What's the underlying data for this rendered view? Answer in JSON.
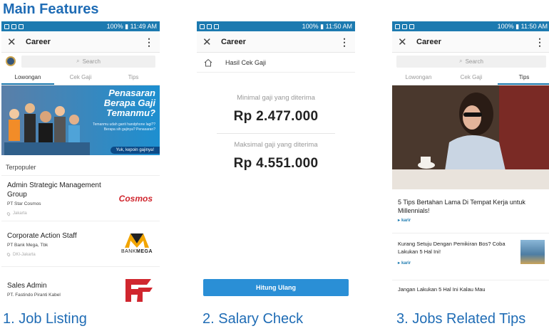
{
  "heading": "Main Features",
  "colors": {
    "accent": "#1f6cb5",
    "status_bar": "#1c7ab0",
    "button": "#2a8fd6",
    "cosmos_red": "#d0262e"
  },
  "screens": [
    {
      "status": {
        "icons": [
          "flipboard-icon",
          "facebook-icon",
          "instagram-icon"
        ],
        "right": "100% ▮ 11:49 AM"
      },
      "app_title": "Career",
      "search_placeholder": "Search",
      "tabs": [
        "Lowongan",
        "Cek Gaji",
        "Tips"
      ],
      "active_tab": 0,
      "banner": {
        "headline": "Penasaran Berapa Gaji Temanmu?",
        "sub": "Temanmu udah ganti handphone lagi?? Berapa sih gajinya? Penasaran?",
        "cta": "Yuk, kepoin gajinya!"
      },
      "section_label": "Terpopuler",
      "jobs": [
        {
          "title": "Admin Strategic Management Group",
          "company": "PT Star Cosmos",
          "location": "Jakarta",
          "logo": "Cosmos"
        },
        {
          "title": "Corporate Action Staff",
          "company": "PT Bank Mega, Tbk",
          "location": "DKI-Jakarta",
          "logo_a": "BANK",
          "logo_b": "MEGA"
        },
        {
          "title": "Sales Admin",
          "company": "PT. Fastindo Piranti Kabel",
          "location": "",
          "logo": "FF"
        }
      ],
      "caption": "1. Job Listing"
    },
    {
      "status": {
        "right": "100% ▮ 11:50 AM"
      },
      "app_title": "Career",
      "breadcrumb": "Hasil Cek Gaji",
      "min_label": "Minimal gaji yang diterima",
      "min_value": "Rp 2.477.000",
      "max_label": "Maksimal gaji yang diterima",
      "max_value": "Rp 4.551.000",
      "button": "Hitung Ulang",
      "caption": "2. Salary Check"
    },
    {
      "status": {
        "right": "100% ▮ 11:50 AM"
      },
      "app_title": "Career",
      "search_placeholder": "Search",
      "tabs": [
        "Lowongan",
        "Cek Gaji",
        "Tips"
      ],
      "active_tab": 2,
      "tip_main": "5 Tips Bertahan Lama Di Tempat Kerja untuk Millennials!",
      "source": "karir",
      "tip_second": "Kurang Setuju Dengan Pemikiran Bos? Coba Lakukan 5 Hal Ini!",
      "tip_third": "Jangan Lakukan 5 Hal Ini Kalau Mau",
      "caption": "3. Jobs Related Tips"
    }
  ]
}
